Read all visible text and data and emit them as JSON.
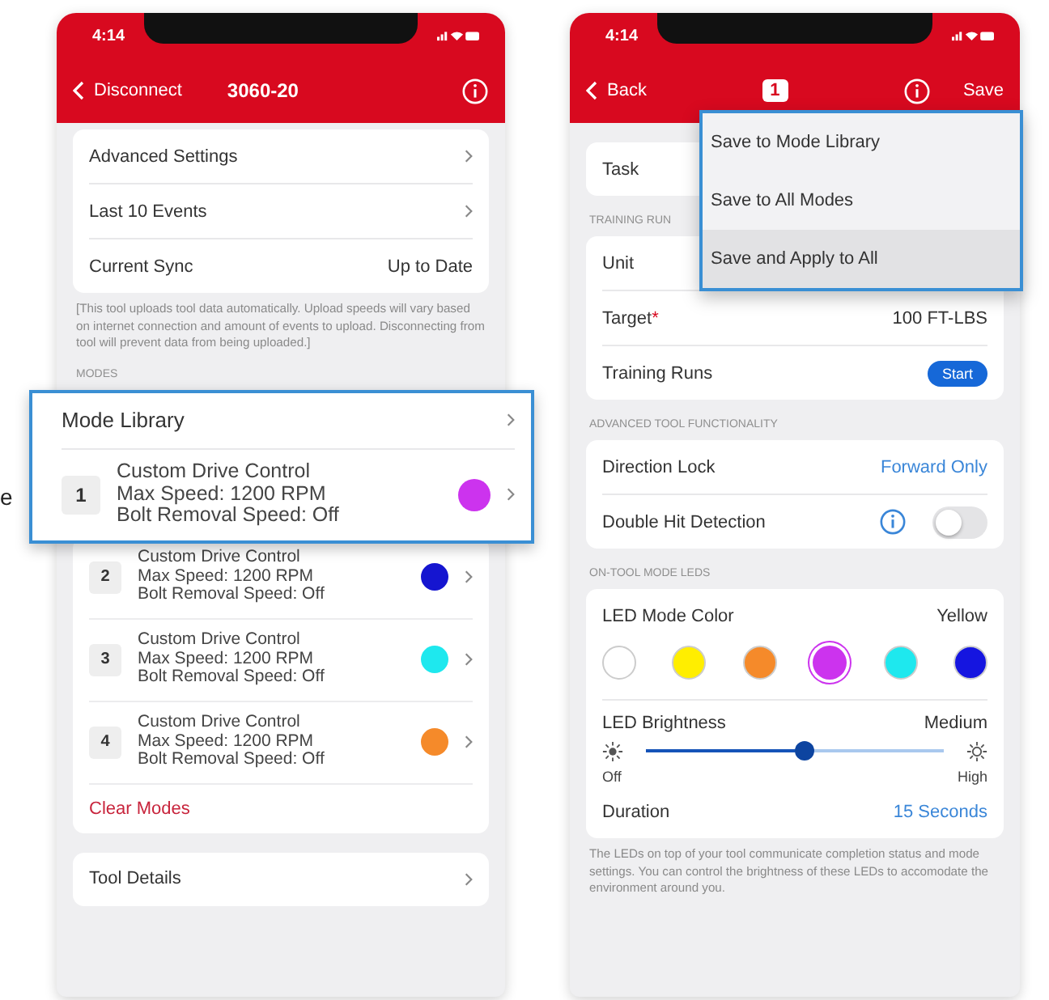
{
  "edge_fragment": "e",
  "left_phone": {
    "status_time": "4:14",
    "nav": {
      "back": "Disconnect",
      "title": "3060-20"
    },
    "settings": [
      {
        "kind": "link",
        "label": "Advanced Settings"
      },
      {
        "kind": "link",
        "label": "Last 10 Events"
      },
      {
        "kind": "value",
        "label": "Current Sync",
        "value": "Up to Date"
      }
    ],
    "note": "[This tool uploads tool data automatically. Upload speeds will vary based on internet connection and amount of events to upload. Disconnecting from tool will prevent data from being uploaded.]",
    "modes_header": "MODES",
    "callout": {
      "label": "Mode Library",
      "mode": {
        "number": "1",
        "name": "Custom Drive Control",
        "max_speed": "Max Speed: 1200 RPM",
        "bolt_removal": "Bolt Removal Speed: Off",
        "color": "#cc33ee"
      }
    },
    "modes": [
      {
        "number": "2",
        "name": "Custom Drive Control",
        "max_speed": "Max Speed: 1200 RPM",
        "bolt_removal": "Bolt Removal Speed: Off",
        "color": "#1515d0"
      },
      {
        "number": "3",
        "name": "Custom Drive Control",
        "max_speed": "Max Speed: 1200 RPM",
        "bolt_removal": "Bolt Removal Speed: Off",
        "color": "#1ee8ee"
      },
      {
        "number": "4",
        "name": "Custom Drive Control",
        "max_speed": "Max Speed: 1200 RPM",
        "bolt_removal": "Bolt Removal Speed: Off",
        "color": "#f58a2a"
      }
    ],
    "clear_modes": "Clear Modes",
    "tool_details": "Tool Details"
  },
  "right_phone": {
    "status_time": "4:14",
    "nav": {
      "back": "Back",
      "badge": "1",
      "save": "Save"
    },
    "task": "Task",
    "training_header": "TRAINING RUN",
    "training": [
      {
        "kind": "value",
        "label": "Unit"
      },
      {
        "kind": "value",
        "label": "Target",
        "required_mark": "*",
        "value": "100 FT-LBS"
      },
      {
        "kind": "button",
        "label": "Training Runs",
        "value": "Start"
      }
    ],
    "save_menu": [
      {
        "label": "Save to Mode Library",
        "selected": false
      },
      {
        "label": "Save to All Modes",
        "selected": false
      },
      {
        "label": "Save and Apply to All",
        "selected": true
      }
    ],
    "advanced_header": "ADVANCED TOOL FUNCTIONALITY",
    "direction_lock": {
      "label": "Direction Lock",
      "value": "Forward Only"
    },
    "double_hit": {
      "label": "Double Hit Detection",
      "on": false
    },
    "leds_header": "ON-TOOL MODE LEDS",
    "led_color": {
      "label": "LED Mode Color",
      "value": "Yellow",
      "swatches": [
        {
          "color": "#ffffff",
          "selected": false
        },
        {
          "color": "#ffee00",
          "selected": false
        },
        {
          "color": "#f58a2a",
          "selected": false
        },
        {
          "color": "#cc33ee",
          "selected": true
        },
        {
          "color": "#1ee8ee",
          "selected": false
        },
        {
          "color": "#1515e0",
          "selected": false
        }
      ]
    },
    "brightness": {
      "label": "LED Brightness",
      "value": "Medium",
      "level": 0.5,
      "min_label": "Off",
      "max_label": "High"
    },
    "duration": {
      "label": "Duration",
      "value": "15 Seconds"
    },
    "note": "The LEDs on top of your tool communicate completion status and mode settings.  You can control the brightness of these LEDs to accomodate the environment around you."
  }
}
